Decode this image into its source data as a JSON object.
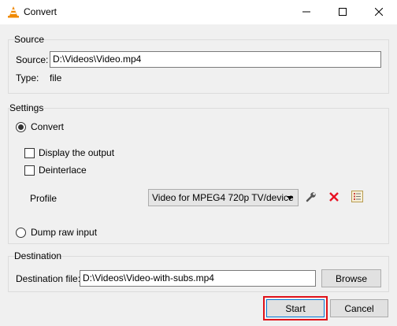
{
  "window": {
    "title": "Convert",
    "icon": "vlc-cone-icon",
    "controls": [
      "minimize-icon",
      "maximize-icon",
      "close-icon"
    ]
  },
  "source": {
    "group_label": "Source",
    "source_label": "Source:",
    "source_value": "D:\\Videos\\Video.mp4",
    "type_label": "Type:",
    "type_value": "file"
  },
  "settings": {
    "group_label": "Settings",
    "convert_label": "Convert",
    "convert_selected": true,
    "display_output_label": "Display the output",
    "display_output_checked": false,
    "deinterlace_label": "Deinterlace",
    "deinterlace_checked": false,
    "profile_label": "Profile",
    "profile_value": "Video for MPEG4 720p TV/device",
    "profile_tool_icons": [
      "wrench-icon",
      "delete-x-icon",
      "new-profile-icon"
    ],
    "dump_raw_label": "Dump raw input",
    "dump_raw_selected": false
  },
  "destination": {
    "group_label": "Destination",
    "file_label": "Destination file:",
    "file_value": "D:\\Videos\\Video-with-subs.mp4",
    "browse_label": "Browse"
  },
  "footer": {
    "start_label": "Start",
    "cancel_label": "Cancel"
  },
  "colors": {
    "highlight_border": "#e0121a",
    "delete_red": "#e81123",
    "vlc_orange": "#f08a00",
    "focus_blue": "#0078d7"
  }
}
